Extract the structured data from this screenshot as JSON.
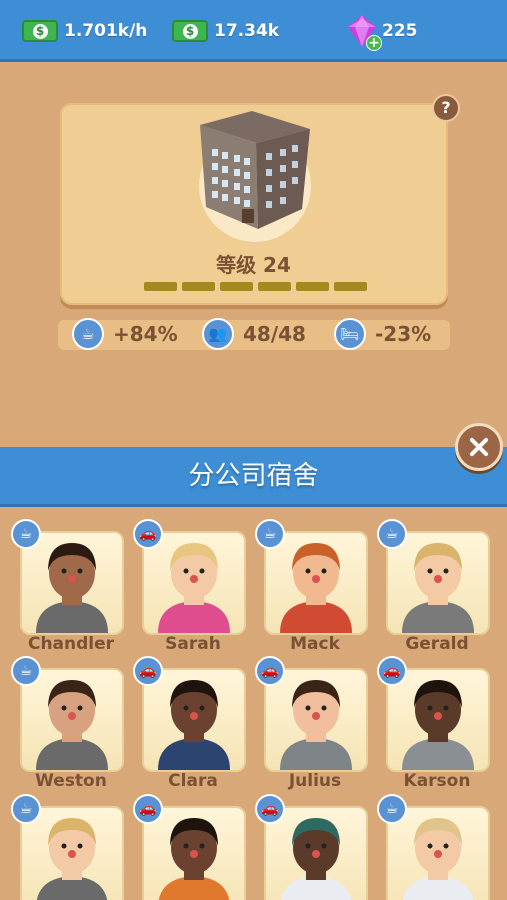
{
  "topbar": {
    "income_rate": "1.701k/h",
    "cash": "17.34k",
    "gems": "225",
    "cash_icon": "cash-icon",
    "gem_icon": "gem-icon"
  },
  "building": {
    "level_label": "等级 24",
    "help_label": "?",
    "level_progress_segments_filled": 6,
    "level_progress_segments_total": 6
  },
  "metrics": [
    {
      "icon": "coffee-icon",
      "value": "+84%"
    },
    {
      "icon": "people-icon",
      "value": "48/48"
    },
    {
      "icon": "bed-icon",
      "value": "-23%"
    }
  ],
  "panel": {
    "title": "分公司宿舍"
  },
  "employees": [
    {
      "name": "Chandler",
      "badge": "coffee-icon"
    },
    {
      "name": "Sarah",
      "badge": "car-icon"
    },
    {
      "name": "Mack",
      "badge": "coffee-icon"
    },
    {
      "name": "Gerald",
      "badge": "coffee-icon"
    },
    {
      "name": "Weston",
      "badge": "coffee-icon"
    },
    {
      "name": "Clara",
      "badge": "car-icon"
    },
    {
      "name": "Julius",
      "badge": "car-icon"
    },
    {
      "name": "Karson",
      "badge": "car-icon"
    },
    {
      "name": "",
      "badge": "coffee-icon"
    },
    {
      "name": "",
      "badge": "car-icon"
    },
    {
      "name": "",
      "badge": "car-icon"
    },
    {
      "name": "",
      "badge": "coffee-icon"
    }
  ],
  "colors": {
    "topbar": "#3e8ed6",
    "background": "#d8a878",
    "card": "#f0cd93",
    "text_brown": "#7a5233",
    "progress": "#a38a1d"
  }
}
